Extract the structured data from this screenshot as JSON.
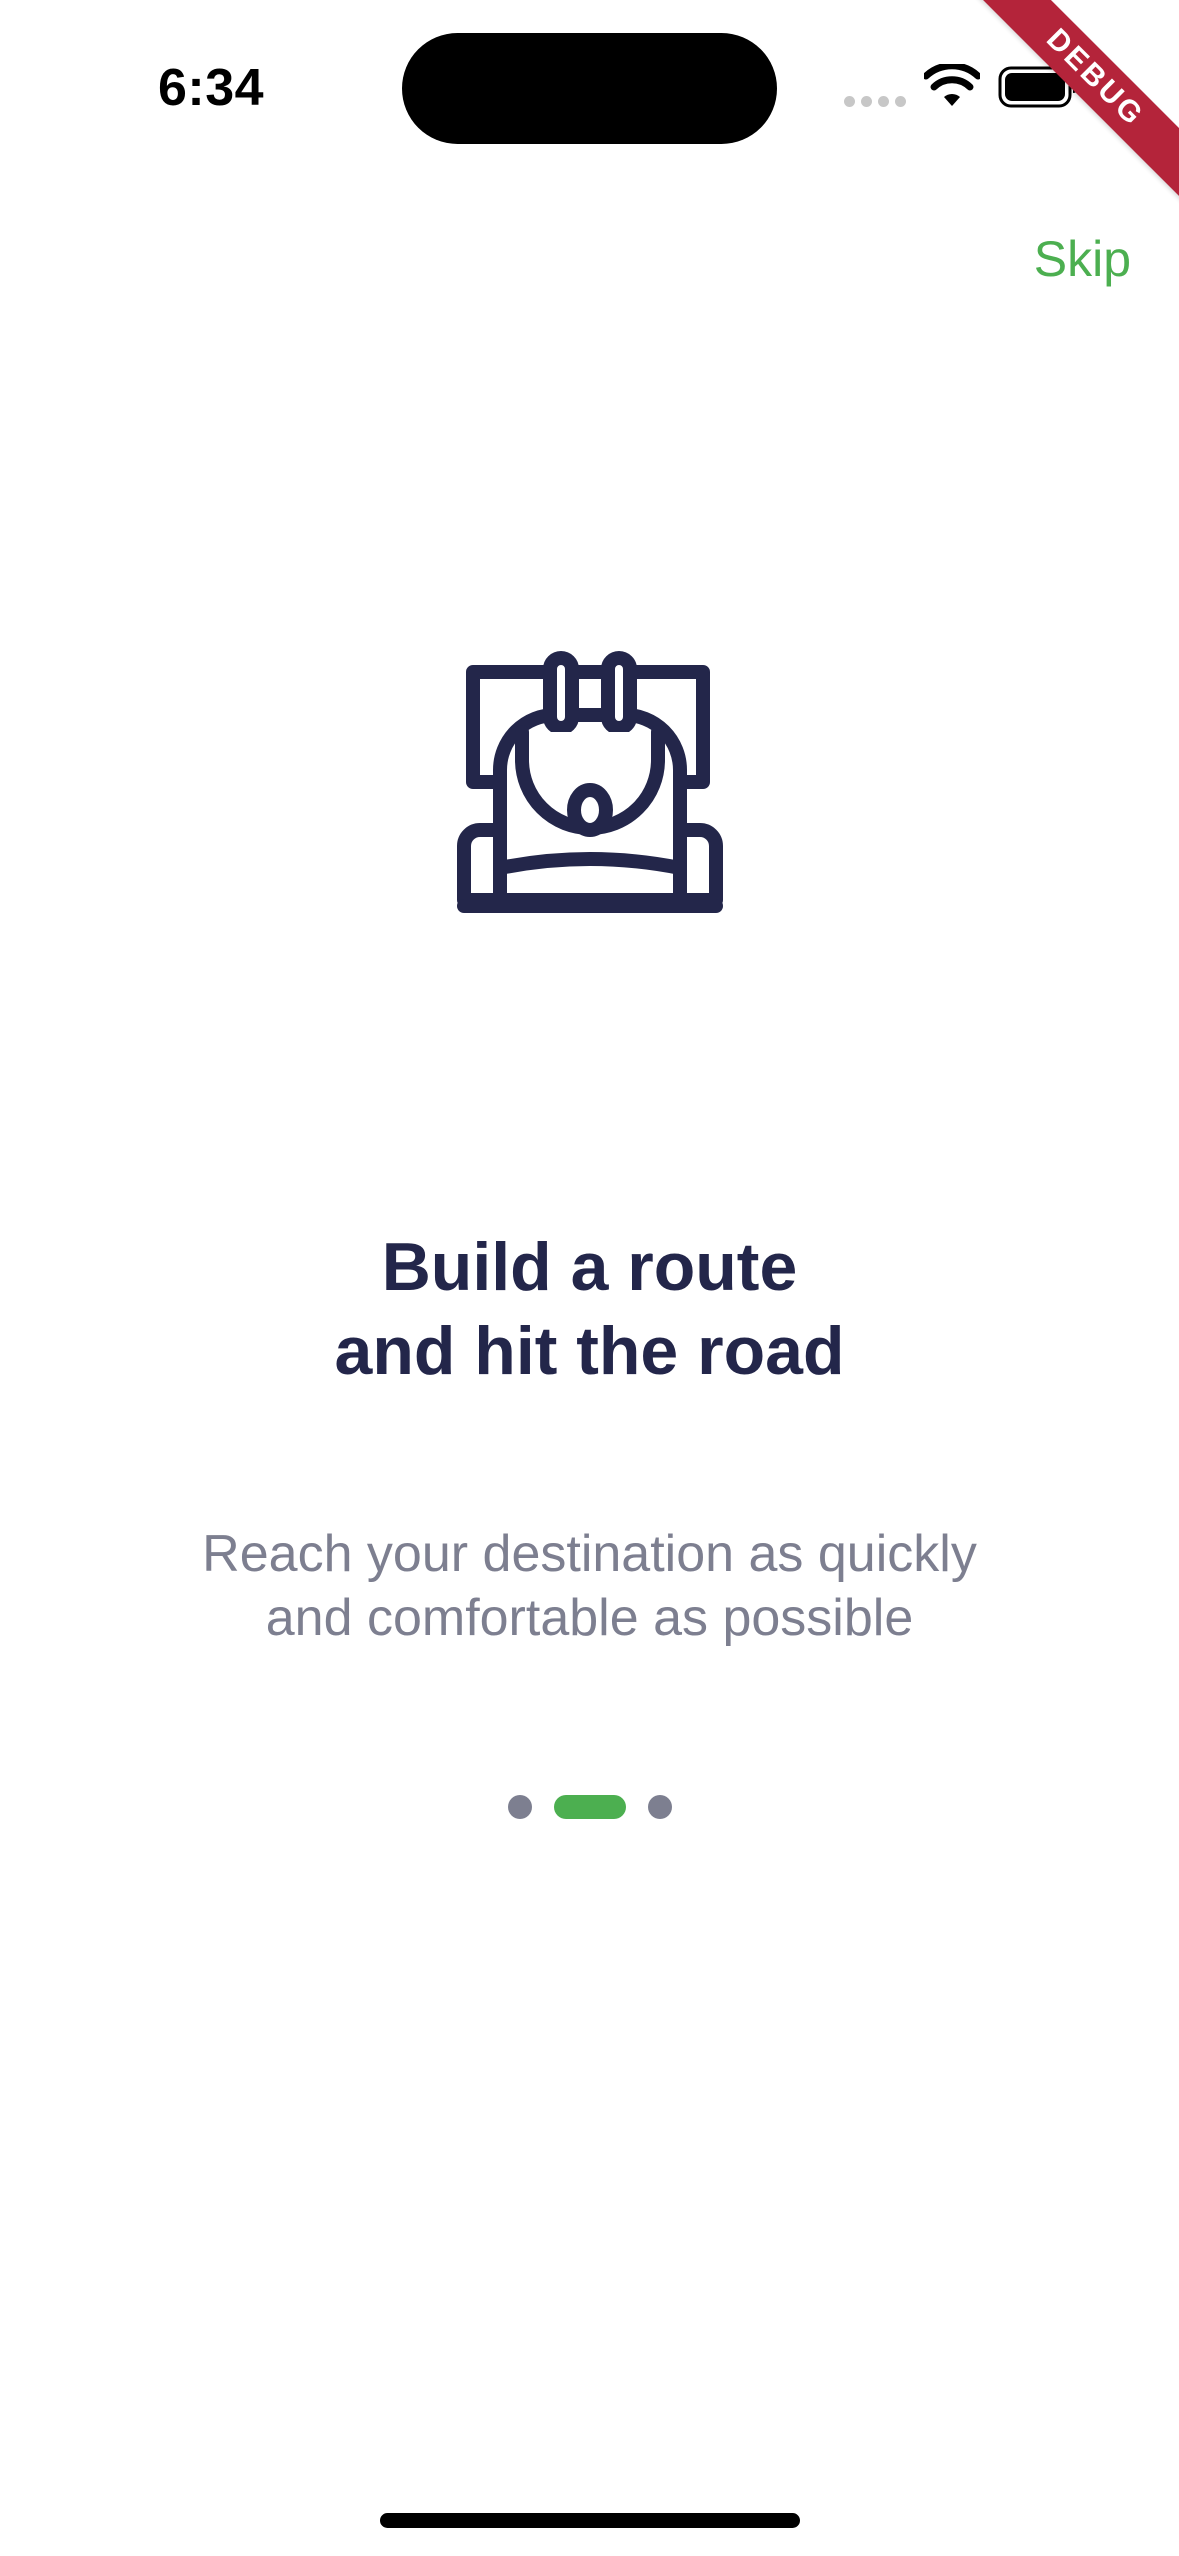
{
  "status_bar": {
    "time": "6:34",
    "icons": [
      "cellular-signal-icon",
      "wifi-icon",
      "battery-icon"
    ]
  },
  "debug_banner": {
    "label": "DEBUG",
    "color": "#b4243a"
  },
  "header": {
    "skip_label": "Skip"
  },
  "slide": {
    "illustration": "backpack-icon",
    "title_lines": [
      "Build a route",
      "and hit the road"
    ],
    "subtitle_lines": [
      "Reach your destination as quickly",
      "and comfortable as possible"
    ]
  },
  "page_indicator": {
    "total": 3,
    "active_index": 1
  },
  "colors": {
    "accent": "#4CAF50",
    "title": "#23264a",
    "subtitle": "#7d7f90",
    "icon": "#23264a",
    "inactive_dot": "#7d7f90"
  }
}
